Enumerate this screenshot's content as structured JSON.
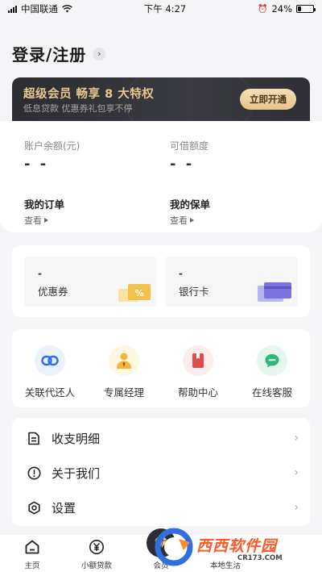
{
  "status_bar": {
    "carrier": "中国联通",
    "time": "下午 4:27",
    "battery": "24%",
    "battery_level": 0.24
  },
  "header": {
    "login_label": "登录/注册"
  },
  "vip_banner": {
    "title": "超级会员 畅享 8 大特权",
    "subtitle": "低息贷款 优惠券礼包享不停",
    "button": "立即开通"
  },
  "account": {
    "balance_label": "账户余额(元)",
    "balance_value": "- -",
    "credit_label": "可借额度",
    "credit_value": "- -",
    "orders_title": "我的订单",
    "orders_link": "查看",
    "policies_title": "我的保单",
    "policies_link": "查看"
  },
  "wallet": {
    "coupon": {
      "value": "-",
      "label": "优惠券"
    },
    "bank_card": {
      "value": "-",
      "label": "银行卡"
    }
  },
  "services": [
    {
      "label": "关联代还人",
      "icon": "link-icon"
    },
    {
      "label": "专属经理",
      "icon": "manager-icon"
    },
    {
      "label": "帮助中心",
      "icon": "help-book-icon"
    },
    {
      "label": "在线客服",
      "icon": "chat-icon"
    }
  ],
  "menu": [
    {
      "label": "收支明细",
      "icon": "document-icon"
    },
    {
      "label": "关于我们",
      "icon": "info-icon"
    },
    {
      "label": "设置",
      "icon": "settings-icon"
    }
  ],
  "tabs": [
    {
      "label": "主页",
      "icon": "home-icon"
    },
    {
      "label": "小额贷款",
      "icon": "yen-icon"
    },
    {
      "label": "会员",
      "icon": "diamond-icon"
    },
    {
      "label": "本地生活",
      "icon": "local-icon"
    }
  ],
  "watermark": {
    "brand": "西西软件园",
    "url": "CR173.COM"
  },
  "colors": {
    "vip_gold": "#e8c88f",
    "accent_blue": "#2d6df6",
    "accent_red": "#e04b4b",
    "accent_green": "#2bb77a"
  }
}
